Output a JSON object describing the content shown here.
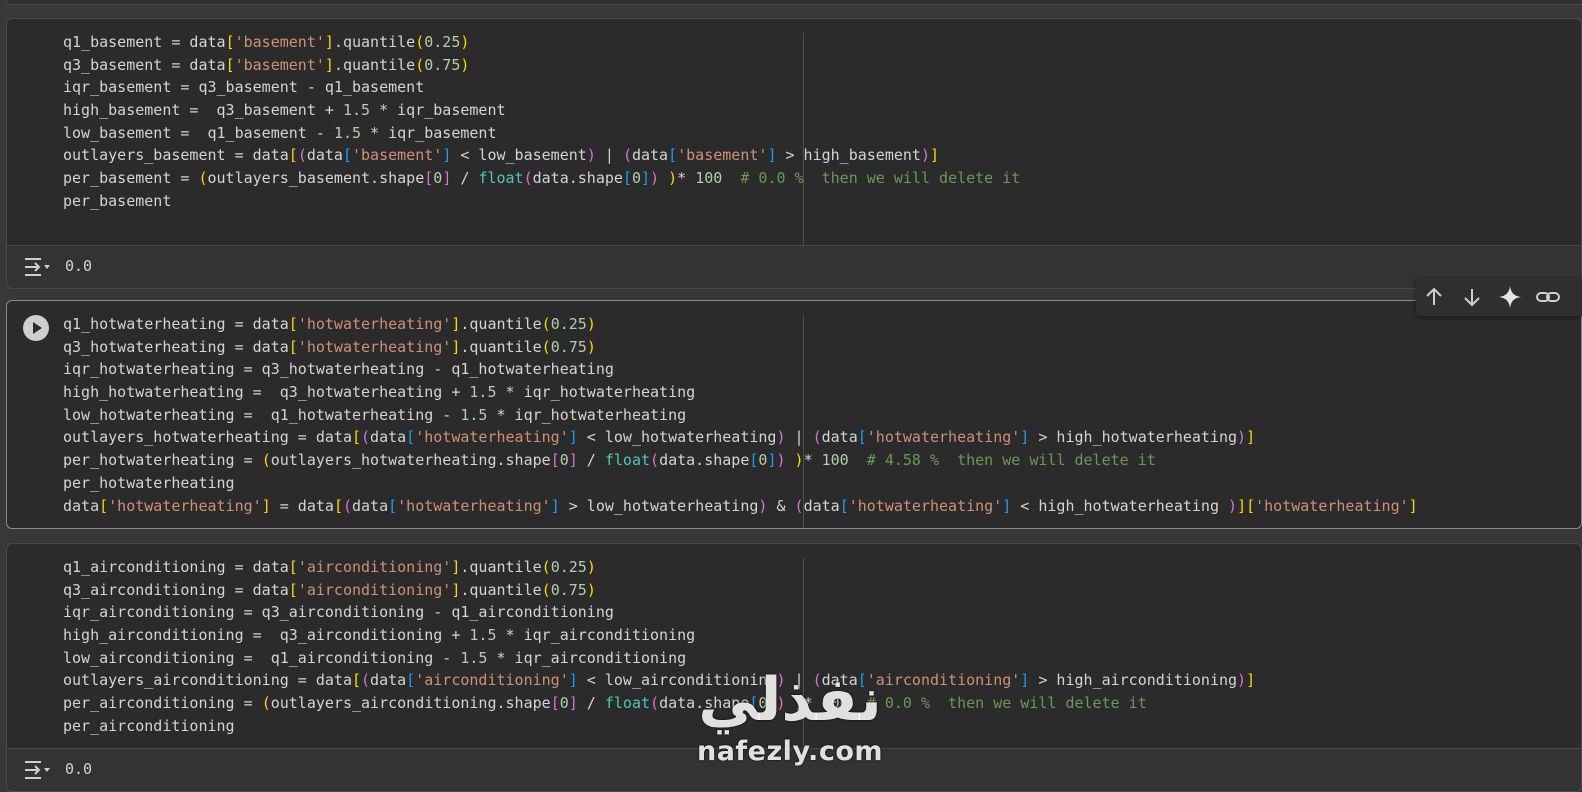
{
  "cells": [
    {
      "id": "basement",
      "lines": [
        [
          [
            "q1_basement = data",
            ""
          ],
          [
            "[",
            "b1"
          ],
          [
            "'basement'",
            "ln-str"
          ],
          [
            "]",
            "b1"
          ],
          [
            ".quantile",
            ""
          ],
          [
            "(",
            "b1"
          ],
          [
            "0.25",
            "ln-num"
          ],
          [
            ")",
            "b1"
          ]
        ],
        [
          [
            "q3_basement = data",
            ""
          ],
          [
            "[",
            "b1"
          ],
          [
            "'basement'",
            "ln-str"
          ],
          [
            "]",
            "b1"
          ],
          [
            ".quantile",
            ""
          ],
          [
            "(",
            "b1"
          ],
          [
            "0.75",
            "ln-num"
          ],
          [
            ")",
            "b1"
          ]
        ],
        [
          [
            "iqr_basement = q3_basement - q1_basement",
            ""
          ]
        ],
        [
          [
            "high_basement =  q3_basement + ",
            ""
          ],
          [
            "1.5",
            "ln-num"
          ],
          [
            " * iqr_basement",
            ""
          ]
        ],
        [
          [
            "low_basement =  q1_basement - ",
            ""
          ],
          [
            "1.5",
            "ln-num"
          ],
          [
            " * iqr_basement",
            ""
          ]
        ],
        [
          [
            "outlayers_basement = data",
            ""
          ],
          [
            "[",
            "b1"
          ],
          [
            "(",
            "b2"
          ],
          [
            "data",
            ""
          ],
          [
            "[",
            "b3"
          ],
          [
            "'basement'",
            "ln-str"
          ],
          [
            "]",
            "b3"
          ],
          [
            " < low_basement",
            ""
          ],
          [
            ")",
            "b2"
          ],
          [
            " | ",
            ""
          ],
          [
            "(",
            "b2"
          ],
          [
            "data",
            ""
          ],
          [
            "[",
            "b3"
          ],
          [
            "'basement'",
            "ln-str"
          ],
          [
            "]",
            "b3"
          ],
          [
            " > high_basement",
            ""
          ],
          [
            ")",
            "b2"
          ],
          [
            "]",
            "b1"
          ]
        ],
        [
          [
            "per_basement = ",
            ""
          ],
          [
            "(",
            "b1"
          ],
          [
            "outlayers_basement.shape",
            ""
          ],
          [
            "[",
            "b2"
          ],
          [
            "0",
            "ln-num"
          ],
          [
            "]",
            "b2"
          ],
          [
            " / ",
            ""
          ],
          [
            "float",
            "ln-fn"
          ],
          [
            "(",
            "b2"
          ],
          [
            "data.shape",
            ""
          ],
          [
            "[",
            "b3"
          ],
          [
            "0",
            "ln-num"
          ],
          [
            "]",
            "b3"
          ],
          [
            ")",
            "b2"
          ],
          [
            " ",
            ""
          ],
          [
            ")",
            "b1"
          ],
          [
            "* ",
            ""
          ],
          [
            "100",
            "ln-num"
          ],
          [
            "  # 0.0 %  then we will delete it",
            "ln-cm"
          ]
        ],
        [
          [
            "per_basement",
            ""
          ]
        ]
      ],
      "output": "0.0"
    },
    {
      "id": "hotwaterheating",
      "lines": [
        [
          [
            "q1_hotwaterheating = data",
            ""
          ],
          [
            "[",
            "b1"
          ],
          [
            "'hotwaterheating'",
            "ln-str"
          ],
          [
            "]",
            "b1"
          ],
          [
            ".quantile",
            ""
          ],
          [
            "(",
            "b1"
          ],
          [
            "0.25",
            "ln-num"
          ],
          [
            ")",
            "b1"
          ]
        ],
        [
          [
            "q3_hotwaterheating = data",
            ""
          ],
          [
            "[",
            "b1"
          ],
          [
            "'hotwaterheating'",
            "ln-str"
          ],
          [
            "]",
            "b1"
          ],
          [
            ".quantile",
            ""
          ],
          [
            "(",
            "b1"
          ],
          [
            "0.75",
            "ln-num"
          ],
          [
            ")",
            "b1"
          ]
        ],
        [
          [
            "iqr_hotwaterheating = q3_hotwaterheating - q1_hotwaterheating",
            ""
          ]
        ],
        [
          [
            "high_hotwaterheating =  q3_hotwaterheating + ",
            ""
          ],
          [
            "1.5",
            "ln-num"
          ],
          [
            " * iqr_hotwaterheating",
            ""
          ]
        ],
        [
          [
            "low_hotwaterheating =  q1_hotwaterheating - ",
            ""
          ],
          [
            "1.5",
            "ln-num"
          ],
          [
            " * iqr_hotwaterheating",
            ""
          ]
        ],
        [
          [
            "outlayers_hotwaterheating = data",
            ""
          ],
          [
            "[",
            "b1"
          ],
          [
            "(",
            "b2"
          ],
          [
            "data",
            ""
          ],
          [
            "[",
            "b3"
          ],
          [
            "'hotwaterheating'",
            "ln-str"
          ],
          [
            "]",
            "b3"
          ],
          [
            " < low_hotwaterheating",
            ""
          ],
          [
            ")",
            "b2"
          ],
          [
            " | ",
            ""
          ],
          [
            "(",
            "b2"
          ],
          [
            "data",
            ""
          ],
          [
            "[",
            "b3"
          ],
          [
            "'hotwaterheating'",
            "ln-str"
          ],
          [
            "]",
            "b3"
          ],
          [
            " > high_hotwaterheating",
            ""
          ],
          [
            ")",
            "b2"
          ],
          [
            "]",
            "b1"
          ]
        ],
        [
          [
            "per_hotwaterheating = ",
            ""
          ],
          [
            "(",
            "b1"
          ],
          [
            "outlayers_hotwaterheating.shape",
            ""
          ],
          [
            "[",
            "b2"
          ],
          [
            "0",
            "ln-num"
          ],
          [
            "]",
            "b2"
          ],
          [
            " / ",
            ""
          ],
          [
            "float",
            "ln-fn"
          ],
          [
            "(",
            "b2"
          ],
          [
            "data.shape",
            ""
          ],
          [
            "[",
            "b3"
          ],
          [
            "0",
            "ln-num"
          ],
          [
            "]",
            "b3"
          ],
          [
            ")",
            "b2"
          ],
          [
            " ",
            ""
          ],
          [
            ")",
            "b1"
          ],
          [
            "* ",
            ""
          ],
          [
            "100",
            "ln-num"
          ],
          [
            "  # 4.58 %  then we will delete it",
            "ln-cm"
          ]
        ],
        [
          [
            "per_hotwaterheating",
            ""
          ]
        ],
        [
          [
            "data",
            ""
          ],
          [
            "[",
            "b1"
          ],
          [
            "'hotwaterheating'",
            "ln-str"
          ],
          [
            "]",
            "b1"
          ],
          [
            " = data",
            ""
          ],
          [
            "[",
            "b1"
          ],
          [
            "(",
            "b2"
          ],
          [
            "data",
            ""
          ],
          [
            "[",
            "b3"
          ],
          [
            "'hotwaterheating'",
            "ln-str"
          ],
          [
            "]",
            "b3"
          ],
          [
            " > low_hotwaterheating",
            ""
          ],
          [
            ")",
            "b2"
          ],
          [
            " & ",
            ""
          ],
          [
            "(",
            "b2"
          ],
          [
            "data",
            ""
          ],
          [
            "[",
            "b3"
          ],
          [
            "'hotwaterheating'",
            "ln-str"
          ],
          [
            "]",
            "b3"
          ],
          [
            " < high_hotwaterheating ",
            ""
          ],
          [
            ")",
            "b2"
          ],
          [
            "]",
            "b1"
          ],
          [
            "[",
            "b1"
          ],
          [
            "'hotwaterheating'",
            "ln-str"
          ],
          [
            "]",
            "b1"
          ]
        ]
      ],
      "output": null
    },
    {
      "id": "airconditioning",
      "lines": [
        [
          [
            "q1_airconditioning = data",
            ""
          ],
          [
            "[",
            "b1"
          ],
          [
            "'airconditioning'",
            "ln-str"
          ],
          [
            "]",
            "b1"
          ],
          [
            ".quantile",
            ""
          ],
          [
            "(",
            "b1"
          ],
          [
            "0.25",
            "ln-num"
          ],
          [
            ")",
            "b1"
          ]
        ],
        [
          [
            "q3_airconditioning = data",
            ""
          ],
          [
            "[",
            "b1"
          ],
          [
            "'airconditioning'",
            "ln-str"
          ],
          [
            "]",
            "b1"
          ],
          [
            ".quantile",
            ""
          ],
          [
            "(",
            "b1"
          ],
          [
            "0.75",
            "ln-num"
          ],
          [
            ")",
            "b1"
          ]
        ],
        [
          [
            "iqr_airconditioning = q3_airconditioning - q1_airconditioning",
            ""
          ]
        ],
        [
          [
            "high_airconditioning =  q3_airconditioning + ",
            ""
          ],
          [
            "1.5",
            "ln-num"
          ],
          [
            " * iqr_airconditioning",
            ""
          ]
        ],
        [
          [
            "low_airconditioning =  q1_airconditioning - ",
            ""
          ],
          [
            "1.5",
            "ln-num"
          ],
          [
            " * iqr_airconditioning",
            ""
          ]
        ],
        [
          [
            "outlayers_airconditioning = data",
            ""
          ],
          [
            "[",
            "b1"
          ],
          [
            "(",
            "b2"
          ],
          [
            "data",
            ""
          ],
          [
            "[",
            "b3"
          ],
          [
            "'airconditioning'",
            "ln-str"
          ],
          [
            "]",
            "b3"
          ],
          [
            " < low_airconditioning",
            ""
          ],
          [
            ")",
            "b2"
          ],
          [
            " | ",
            ""
          ],
          [
            "(",
            "b2"
          ],
          [
            "data",
            ""
          ],
          [
            "[",
            "b3"
          ],
          [
            "'airconditioning'",
            "ln-str"
          ],
          [
            "]",
            "b3"
          ],
          [
            " > high_airconditioning",
            ""
          ],
          [
            ")",
            "b2"
          ],
          [
            "]",
            "b1"
          ]
        ],
        [
          [
            "per_airconditioning = ",
            ""
          ],
          [
            "(",
            "b1"
          ],
          [
            "outlayers_airconditioning.shape",
            ""
          ],
          [
            "[",
            "b2"
          ],
          [
            "0",
            "ln-num"
          ],
          [
            "]",
            "b2"
          ],
          [
            " / ",
            ""
          ],
          [
            "float",
            "ln-fn"
          ],
          [
            "(",
            "b2"
          ],
          [
            "data.shape",
            ""
          ],
          [
            "[",
            "b3"
          ],
          [
            "0",
            "ln-num"
          ],
          [
            "]",
            "b3"
          ],
          [
            ")",
            "b2"
          ],
          [
            " ",
            ""
          ],
          [
            ")",
            "b1"
          ],
          [
            "* ",
            ""
          ],
          [
            "100",
            "ln-num"
          ],
          [
            "  # 0.0 %  then we will delete it",
            "ln-cm"
          ]
        ],
        [
          [
            "per_airconditioning",
            ""
          ]
        ]
      ],
      "output": "0.0"
    }
  ],
  "cell_toolbar": {
    "icons": [
      "arrow-up-icon",
      "arrow-down-icon",
      "sparkle-icon",
      "link-icon"
    ]
  },
  "watermark": {
    "arabic": "نفذلي",
    "latin": "nafezly.com"
  },
  "colors": {
    "background": "#383838",
    "editor": "#2b2b2b",
    "string": "#ce9178",
    "number": "#b5cea8",
    "comment": "#6a9955",
    "builtin": "#4ec9b0",
    "bracket1": "#ffd700",
    "bracket2": "#da70d6",
    "bracket3": "#179fff"
  }
}
